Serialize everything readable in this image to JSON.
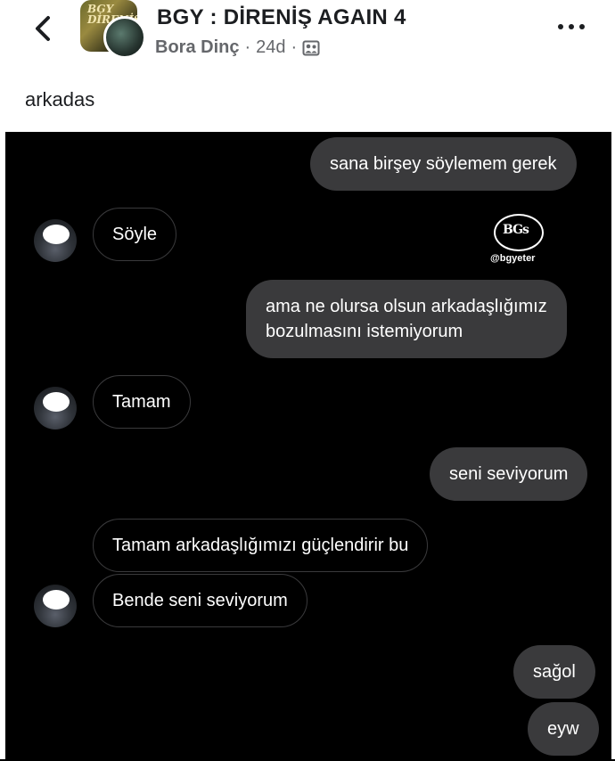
{
  "header": {
    "title": "BGY : DİRENİŞ AGAIN 4",
    "author": "Bora Dinç",
    "separator": "·",
    "time": "24d",
    "avatar_text": "BGY DİRENİŞ",
    "icons": {
      "back": "chevron-left-icon",
      "privacy": "group-icon",
      "more": "more-horizontal-icon"
    }
  },
  "post": {
    "text": "arkadas"
  },
  "chat": {
    "watermark": {
      "logo": "BGs",
      "tag": "@bgyeter"
    },
    "messages": [
      {
        "side": "sent",
        "text": "sana birşey söylemem gerek"
      },
      {
        "side": "received",
        "text": "Söyle"
      },
      {
        "side": "sent",
        "line1": "ama ne olursa olsun arkadaşlığımız",
        "line2": "bozulmasını istemiyorum"
      },
      {
        "side": "received",
        "text": "Tamam"
      },
      {
        "side": "sent",
        "text": "seni seviyorum"
      },
      {
        "side": "received",
        "text": "Tamam arkadaşlığımızı güçlendirir bu"
      },
      {
        "side": "received",
        "text": "Bende seni seviyorum"
      },
      {
        "side": "sent",
        "text": "sağol"
      },
      {
        "side": "sent",
        "text": "eyw"
      }
    ]
  },
  "colors": {
    "sent_bubble": "#3a3a3c",
    "chat_bg": "#000000",
    "meta_gray": "#65676b"
  }
}
